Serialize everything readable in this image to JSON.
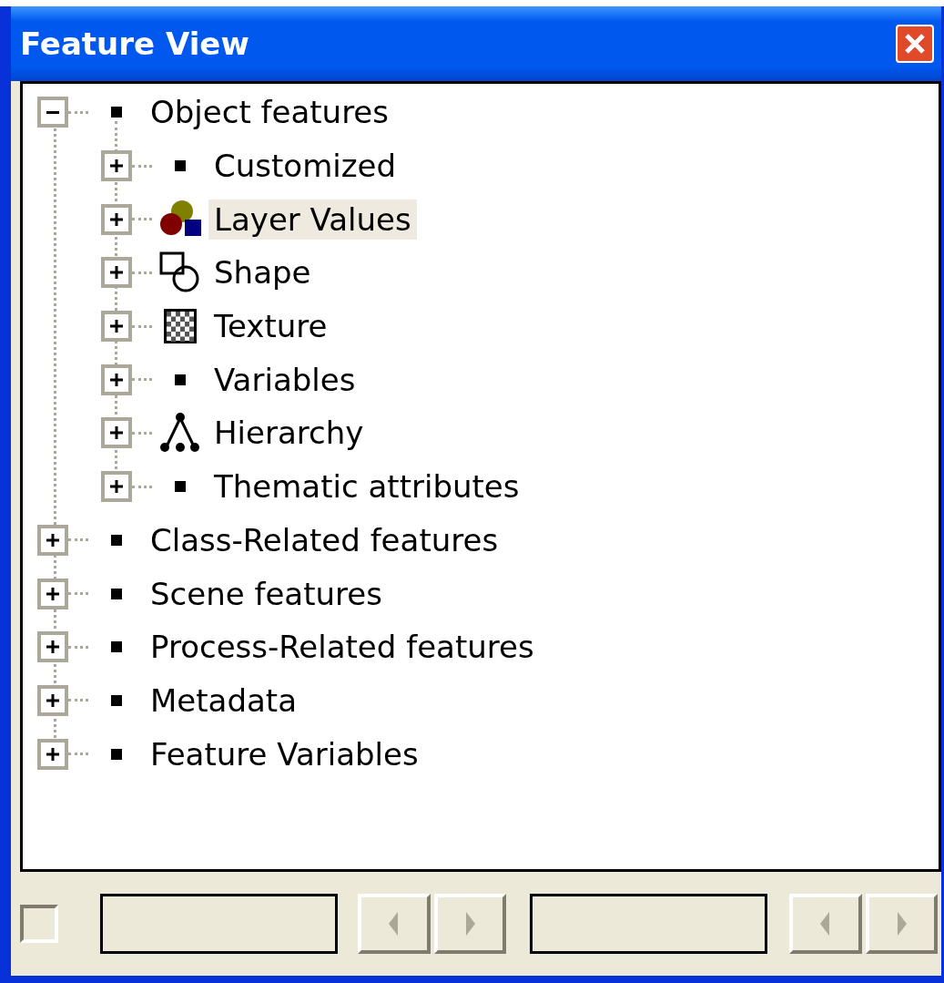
{
  "window": {
    "title": "Feature View"
  },
  "tree": [
    {
      "label": "Object features",
      "kind": "bullet",
      "expanded": true,
      "selected": false,
      "children": [
        {
          "label": "Customized",
          "kind": "bullet",
          "expanded": false,
          "selected": false
        },
        {
          "label": "Layer Values",
          "kind": "layers",
          "expanded": false,
          "selected": true
        },
        {
          "label": "Shape",
          "kind": "shape",
          "expanded": false,
          "selected": false
        },
        {
          "label": "Texture",
          "kind": "texture",
          "expanded": false,
          "selected": false
        },
        {
          "label": "Variables",
          "kind": "bullet",
          "expanded": false,
          "selected": false
        },
        {
          "label": "Hierarchy",
          "kind": "hierarchy",
          "expanded": false,
          "selected": false
        },
        {
          "label": "Thematic attributes",
          "kind": "bullet",
          "expanded": false,
          "selected": false
        }
      ]
    },
    {
      "label": "Class-Related features",
      "kind": "bullet",
      "expanded": false,
      "selected": false
    },
    {
      "label": "Scene features",
      "kind": "bullet",
      "expanded": false,
      "selected": false
    },
    {
      "label": "Process-Related features",
      "kind": "bullet",
      "expanded": false,
      "selected": false
    },
    {
      "label": "Metadata",
      "kind": "bullet",
      "expanded": false,
      "selected": false
    },
    {
      "label": "Feature Variables",
      "kind": "bullet",
      "expanded": false,
      "selected": false
    }
  ],
  "bottom_bar": {
    "checkbox": {
      "checked": false
    }
  }
}
